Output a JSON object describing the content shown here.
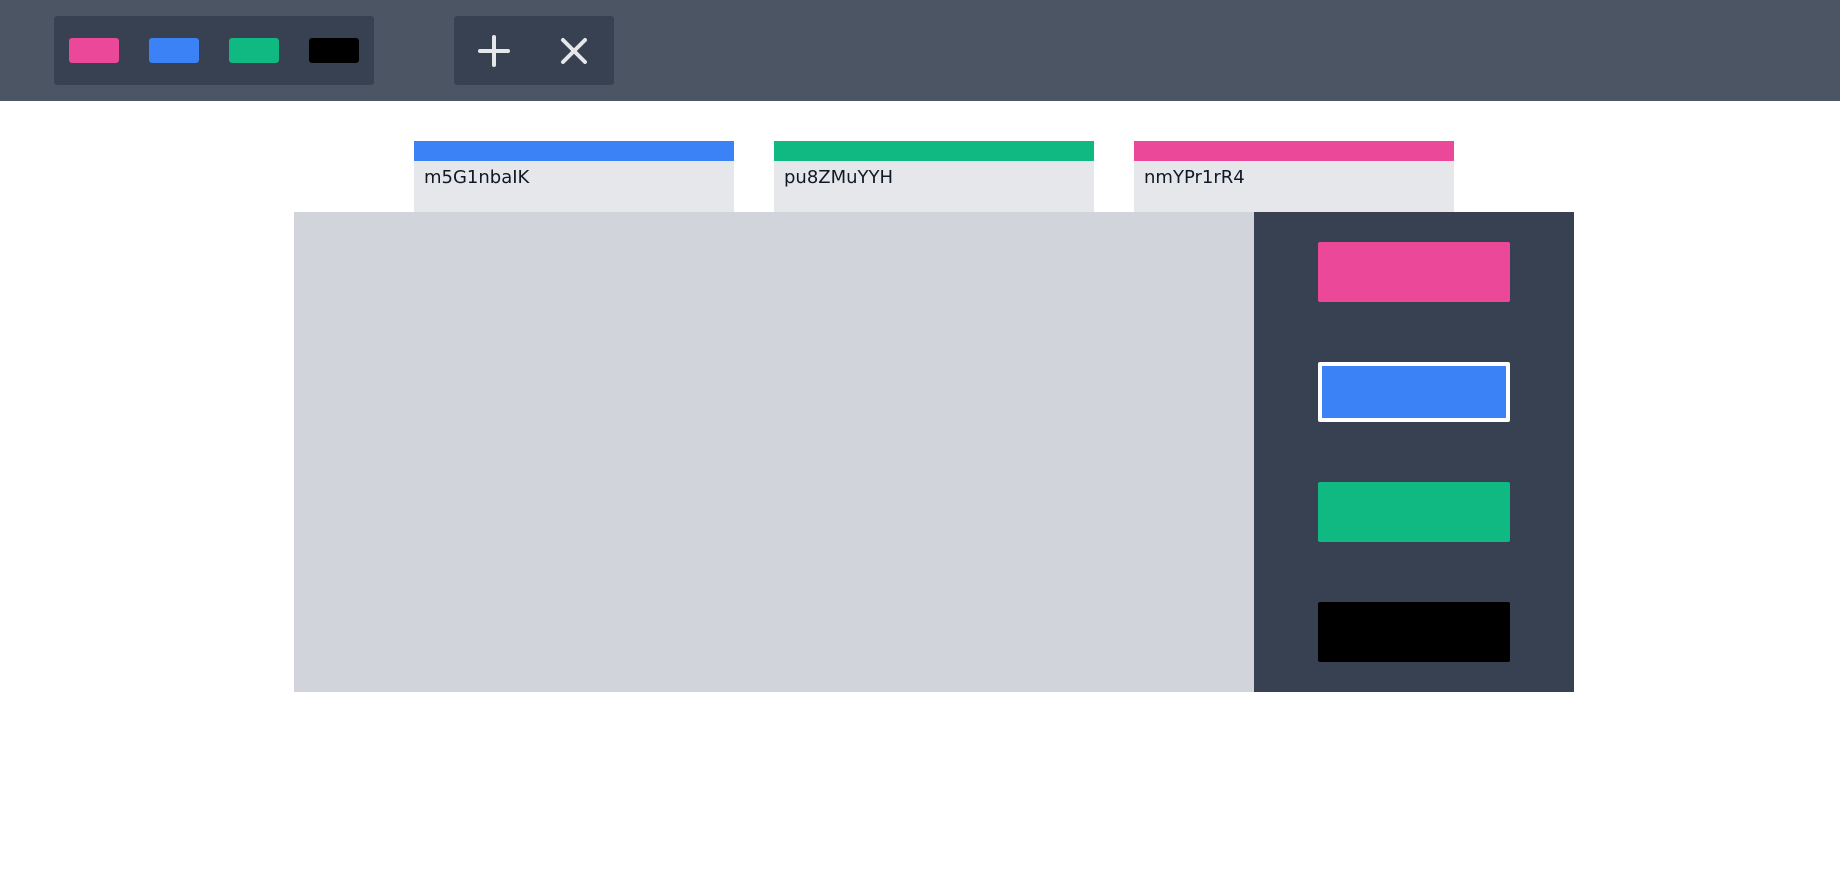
{
  "toolbar": {
    "swatches": [
      {
        "name": "pink",
        "color": "#ec4899"
      },
      {
        "name": "blue",
        "color": "#3b82f6"
      },
      {
        "name": "green",
        "color": "#10b981"
      },
      {
        "name": "black",
        "color": "#000000"
      }
    ],
    "actions": [
      {
        "name": "add",
        "icon": "plus-icon"
      },
      {
        "name": "close",
        "icon": "close-icon"
      }
    ]
  },
  "tabs": [
    {
      "label": "m5G1nbaIK",
      "color": "#3b82f6"
    },
    {
      "label": "pu8ZMuYYH",
      "color": "#10b981"
    },
    {
      "label": "nmYPr1rR4",
      "color": "#ec4899"
    }
  ],
  "palette": {
    "selected_index": 1,
    "colors": [
      {
        "name": "pink",
        "color": "#ec4899"
      },
      {
        "name": "blue",
        "color": "#3b82f6"
      },
      {
        "name": "green",
        "color": "#10b981"
      },
      {
        "name": "black",
        "color": "#000000"
      }
    ]
  },
  "theme": {
    "topbar_bg": "#4b5563",
    "group_bg": "#374151",
    "canvas_bg": "#d1d5db",
    "tab_bg": "#e5e7eb",
    "icon_color": "#e5e7eb"
  }
}
